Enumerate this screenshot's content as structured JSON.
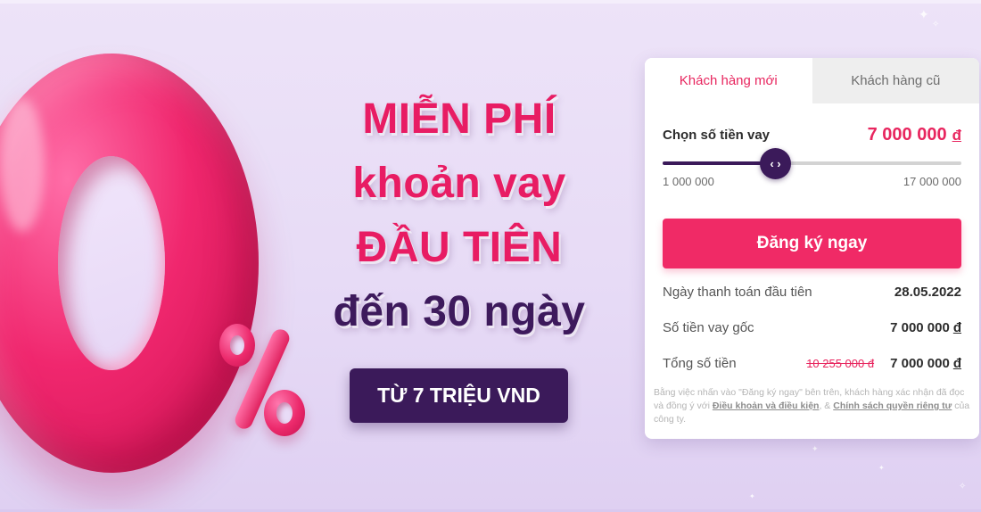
{
  "hero": {
    "headline_line1": "MIỄN PHÍ",
    "headline_line2": "khoản vay",
    "headline_line3": "ĐẦU TIÊN",
    "headline_line4": "đến 30 ngày",
    "promo_button_label": "TỪ 7 TRIỆU VND",
    "colors": {
      "pink": "#e81c63",
      "purple": "#3d1a5c"
    }
  },
  "loan_card": {
    "tabs": [
      {
        "label": "Khách hàng mới",
        "active": true
      },
      {
        "label": "Khách hàng cũ",
        "active": false
      }
    ],
    "amount_label": "Chọn số tiền vay",
    "amount_value": "7 000 000",
    "currency": "đ",
    "slider": {
      "min_label": "1 000 000",
      "max_label": "17 000 000",
      "thumb_icon": "‹ ›",
      "level": 0.375
    },
    "submit_label": "Đăng ký ngay",
    "rows": [
      {
        "label": "Ngày thanh toán đầu tiên",
        "value": "28.05.2022"
      },
      {
        "label": "Số tiền vay gốc",
        "value": "7 000 000"
      },
      {
        "label": "Tổng số tiền",
        "original_value": "10 255 000 đ",
        "value": "7 000 000"
      }
    ],
    "disclaimer": {
      "text_before": "Bằng việc nhấn vào \"Đăng ký ngay\" bên trên, khách hàng xác nhận đã đọc và đồng ý với ",
      "terms_link": "Điều khoản và điều kiện",
      "separator": ", & ",
      "privacy_link": "Chính sách quyền riêng tư",
      "text_after": " của công ty."
    },
    "colors": {
      "accent": "#e8265f",
      "button": "#f02a66",
      "slider": "#3b1a5a"
    }
  }
}
